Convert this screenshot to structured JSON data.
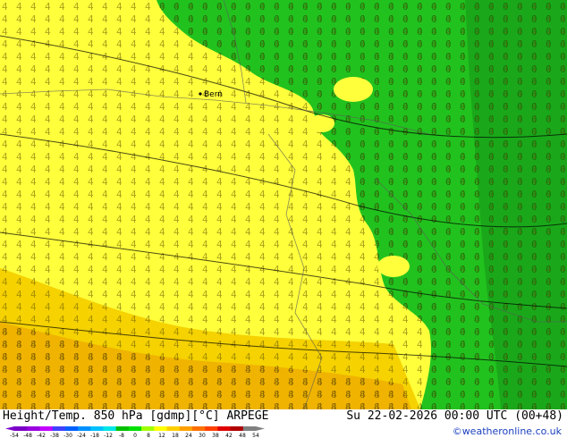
{
  "header": {
    "product": "Height/Temp. 850 hPa [gdmp][°C] ARPEGE",
    "valid_time": "Su 22-02-2026 00:00 UTC (00+48)"
  },
  "credit": "©weatheronline.co.uk",
  "map": {
    "city_label": "Bern",
    "colors": {
      "land_green": "#22c21e",
      "dark_green": "#0f9e0f",
      "yellow_warm": "#ffff3c",
      "yellow_mid": "#f5e623",
      "orange": "#f0c800",
      "contour": "#000000",
      "border": "#555555"
    }
  },
  "colorbar": {
    "ticks": [
      "-54",
      "-48",
      "-42",
      "-38",
      "-30",
      "-24",
      "-18",
      "-12",
      "-8",
      "0",
      "8",
      "12",
      "18",
      "24",
      "30",
      "38",
      "42",
      "48",
      "54"
    ],
    "colors": [
      "#7a00c8",
      "#9a00e0",
      "#c400ff",
      "#4040ff",
      "#0060ff",
      "#0090ff",
      "#00c0ff",
      "#00e6e6",
      "#00c000",
      "#00e000",
      "#a0ff00",
      "#ffff00",
      "#ffd000",
      "#ffa000",
      "#ff7000",
      "#ff4000",
      "#e00000",
      "#b00000",
      "#808080"
    ]
  }
}
